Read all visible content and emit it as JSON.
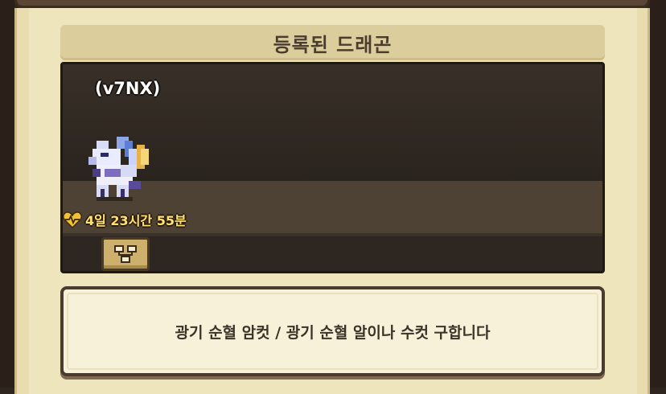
{
  "title": "등록된 드래곤",
  "dragon": {
    "name": "(v7NX)",
    "timer": "4일 23시간 55분",
    "sprite": "white-dragon-sprite"
  },
  "buttons": {
    "family_tree": "family-tree-icon"
  },
  "message": "광기 순혈 암컷 / 광기 순혈 알이나 수컷 구합니다",
  "colors": {
    "frame": "#e9ddb0",
    "panel": "#2a231d",
    "timer_text": "#ffe070",
    "heart": "#f1c232"
  }
}
